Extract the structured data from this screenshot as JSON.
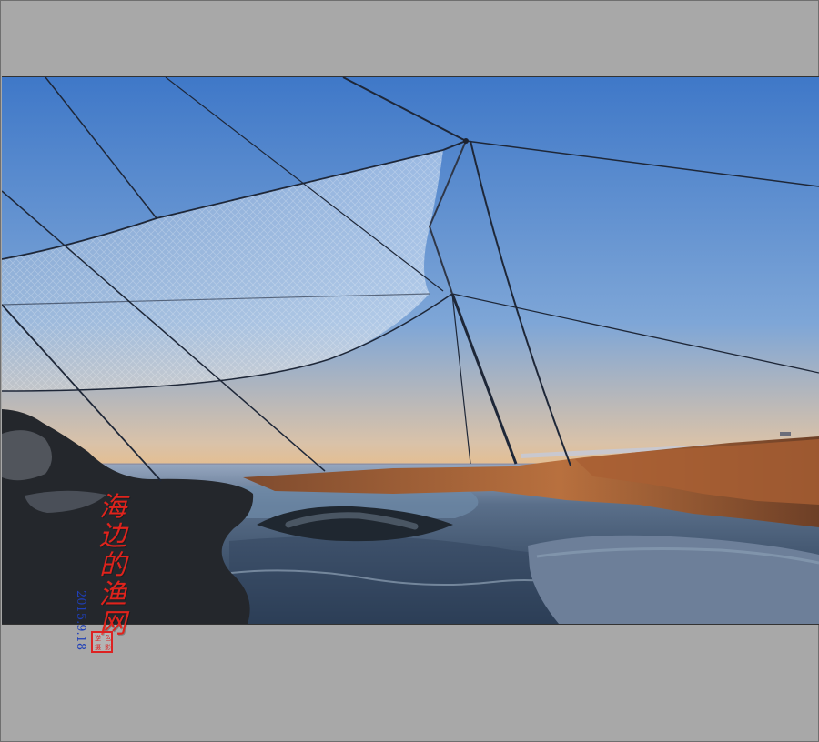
{
  "image": {
    "subject": "fishing-net-at-sunset",
    "title_text": "海边的渔网",
    "date_text": "2015.9.18",
    "seal_text": "逆色摄影",
    "colors": {
      "frame": "#a8a8a8",
      "sky_top": "#3f78c8",
      "sky_horizon": "#f0bf7e",
      "seal_red": "#d22222",
      "date_blue": "#1f3fb8"
    }
  }
}
